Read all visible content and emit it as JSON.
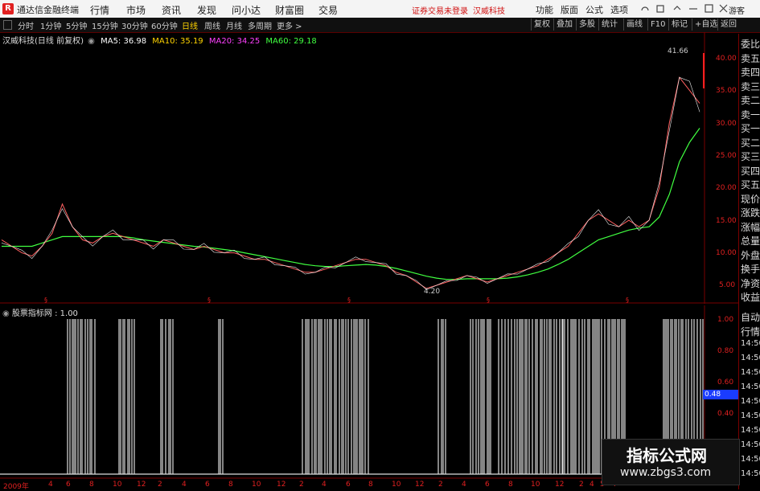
{
  "titlebar": {
    "app_name": "通达信金融终端",
    "menu": [
      "行情",
      "市场",
      "资讯",
      "发现",
      "问小达",
      "财富圈",
      "交易"
    ],
    "notice": "证券交易未登录",
    "stock": "汉威科技",
    "right": [
      "功能",
      "版面",
      "公式",
      "选项"
    ],
    "guest": "游客"
  },
  "toolbar": {
    "periods": [
      "分时",
      "1分钟",
      "5分钟",
      "15分钟",
      "30分钟",
      "60分钟",
      "日线",
      "周线",
      "月线",
      "多周期",
      "更多 >"
    ],
    "active": "日线",
    "right_buttons": [
      "复权",
      "叠加",
      "多股",
      "统计",
      "画线",
      "F10",
      "标记",
      "+自选",
      "返回"
    ]
  },
  "chart_head": {
    "stock_label": "汉威科技(日线 前复权)",
    "ma5": "MA5: 36.98",
    "ma10": "MA10: 35.19",
    "ma20": "MA20: 34.25",
    "ma60": "MA60: 29.18",
    "colors": {
      "ma5": "#ffffff",
      "ma10": "#ffd400",
      "ma20": "#ff40ff",
      "ma60": "#40ff40"
    }
  },
  "price_axis": [
    "40.00",
    "35.00",
    "30.00",
    "25.00",
    "20.00",
    "15.00",
    "10.00",
    "5.00"
  ],
  "annotations": {
    "high": "41.66",
    "low": "4.20"
  },
  "indicator": {
    "title": "股票指标网 : 1.00",
    "axis": [
      "1.00",
      "0.80",
      "0.60",
      "0.40"
    ],
    "current": "0.48"
  },
  "date_axis": [
    "2009年",
    "4",
    "6",
    "8",
    "10",
    "12",
    "2",
    "4",
    "6",
    "8",
    "10",
    "12",
    "2",
    "4",
    "6",
    "8",
    "10",
    "12",
    "2",
    "4",
    "6",
    "8",
    "10",
    "12",
    "2",
    "4",
    "5",
    "7"
  ],
  "side_panel": [
    "委比",
    "卖五",
    "卖四",
    "卖三",
    "卖二",
    "卖一",
    "买一",
    "买二",
    "买三",
    "买四",
    "买五",
    "现价",
    "涨跌",
    "涨幅",
    "总量",
    "外盘",
    "换手",
    "净资",
    "收益"
  ],
  "side_panel2": [
    "自动",
    "行情",
    "14:50",
    "14:50",
    "14:50",
    "14:50",
    "14:50",
    "14:50",
    "14:50",
    "14:50",
    "14:50",
    "14:50"
  ],
  "watermark": {
    "title": "指标公式网",
    "url": "www.zbgs3.com"
  },
  "chart_data": {
    "type": "line",
    "x_range": [
      "2009-01",
      "2015-06"
    ],
    "y_range": [
      4,
      42
    ],
    "price_series": [
      12,
      11,
      10,
      9.5,
      11,
      13,
      17.5,
      14,
      12,
      11.5,
      12.5,
      13,
      12.5,
      12,
      11.5,
      11,
      12,
      11.5,
      11,
      10.5,
      11,
      10.5,
      10,
      10,
      9.5,
      9,
      9,
      8.5,
      8,
      7.5,
      7,
      7,
      7.5,
      8,
      8.5,
      9,
      9,
      8.5,
      8,
      7,
      6.5,
      5.5,
      4.5,
      5,
      5.5,
      6,
      6.5,
      6,
      5.5,
      6,
      6.5,
      7,
      7.5,
      8,
      9,
      10,
      11,
      13,
      15,
      16,
      15,
      14,
      15,
      14,
      15,
      20,
      30,
      37,
      35,
      33
    ],
    "ma60_series": [
      11,
      11,
      11,
      11,
      11.5,
      12,
      12.5,
      12.5,
      12.5,
      12.5,
      12.5,
      12.5,
      12.5,
      12.3,
      12,
      11.8,
      11.6,
      11.4,
      11.2,
      11,
      10.9,
      10.7,
      10.5,
      10.3,
      10,
      9.7,
      9.4,
      9.1,
      8.8,
      8.5,
      8.2,
      8,
      7.9,
      7.9,
      8,
      8.1,
      8.2,
      8.1,
      7.9,
      7.6,
      7.2,
      6.8,
      6.4,
      6.1,
      5.9,
      5.9,
      6,
      6,
      6,
      6,
      6.1,
      6.3,
      6.6,
      7,
      7.5,
      8.2,
      9,
      10,
      11,
      12,
      12.5,
      13,
      13.5,
      13.8,
      14,
      15.5,
      19,
      24,
      27,
      29.18
    ]
  }
}
